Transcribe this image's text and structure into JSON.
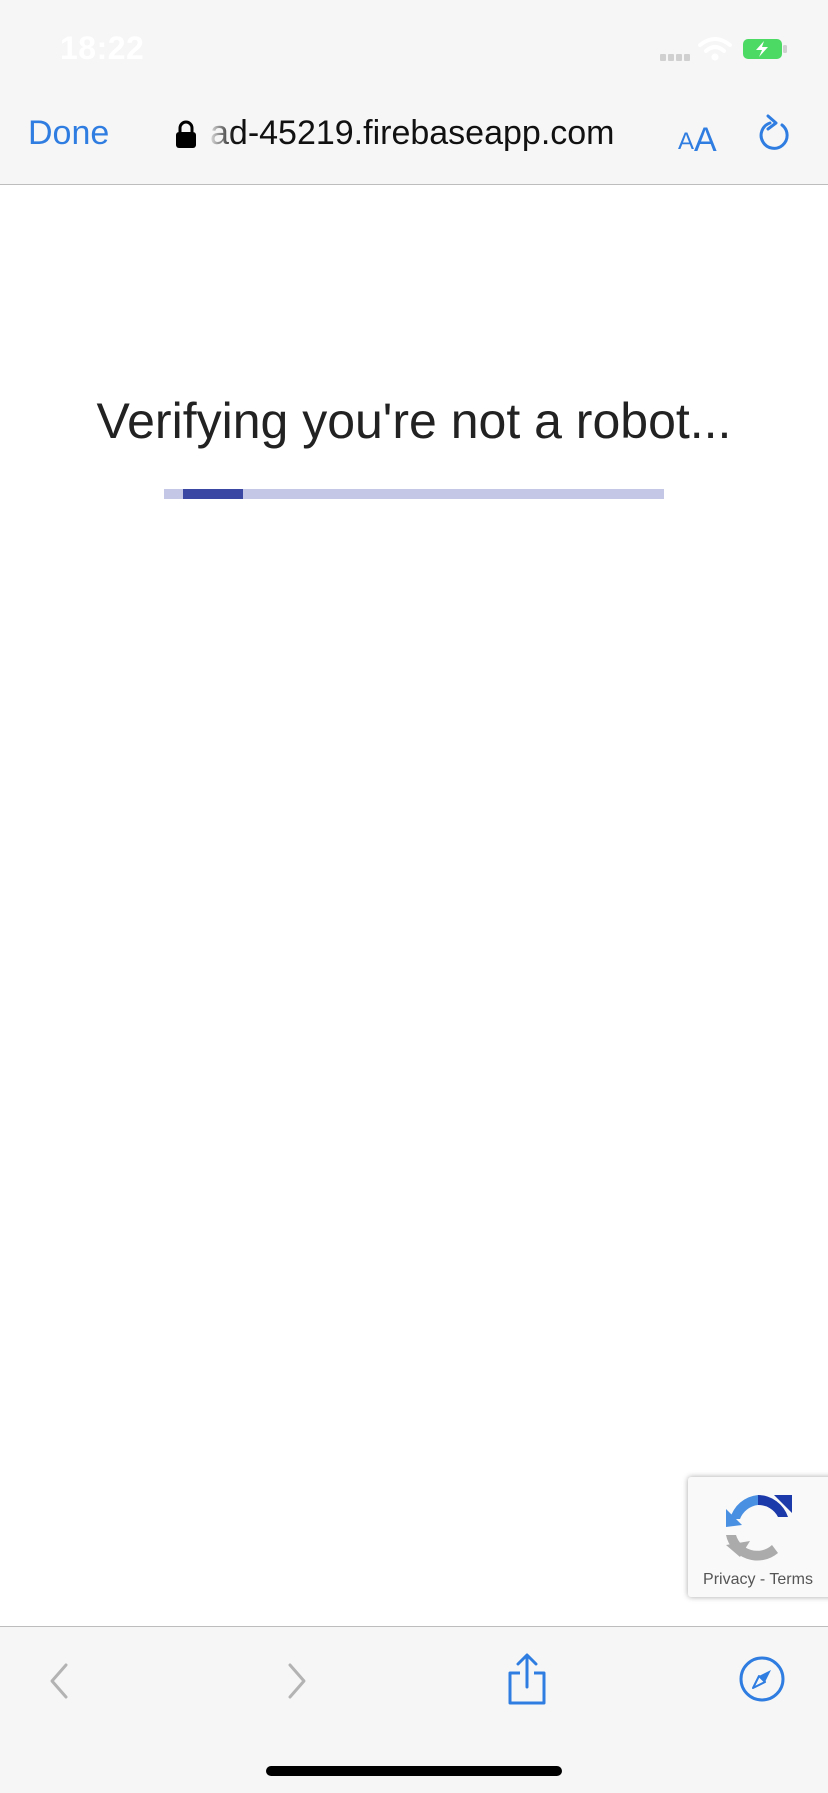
{
  "status_bar": {
    "time": "18:22"
  },
  "nav": {
    "done_label": "Done",
    "url": "ad-45219.firebaseapp.com",
    "text_size_small": "A",
    "text_size_large": "A"
  },
  "page": {
    "message": "Verifying you're not a robot...",
    "progress": 0.12
  },
  "recaptcha": {
    "privacy": "Privacy",
    "separator": "-",
    "terms": "Terms"
  },
  "toolbar": {
    "icons": [
      "back-icon",
      "forward-icon",
      "share-icon",
      "compass-icon"
    ]
  },
  "colors": {
    "accent": "#2f7de1",
    "progress_fill": "#3a47a3",
    "progress_track": "#c5c7e6",
    "battery": "#4cd964"
  }
}
